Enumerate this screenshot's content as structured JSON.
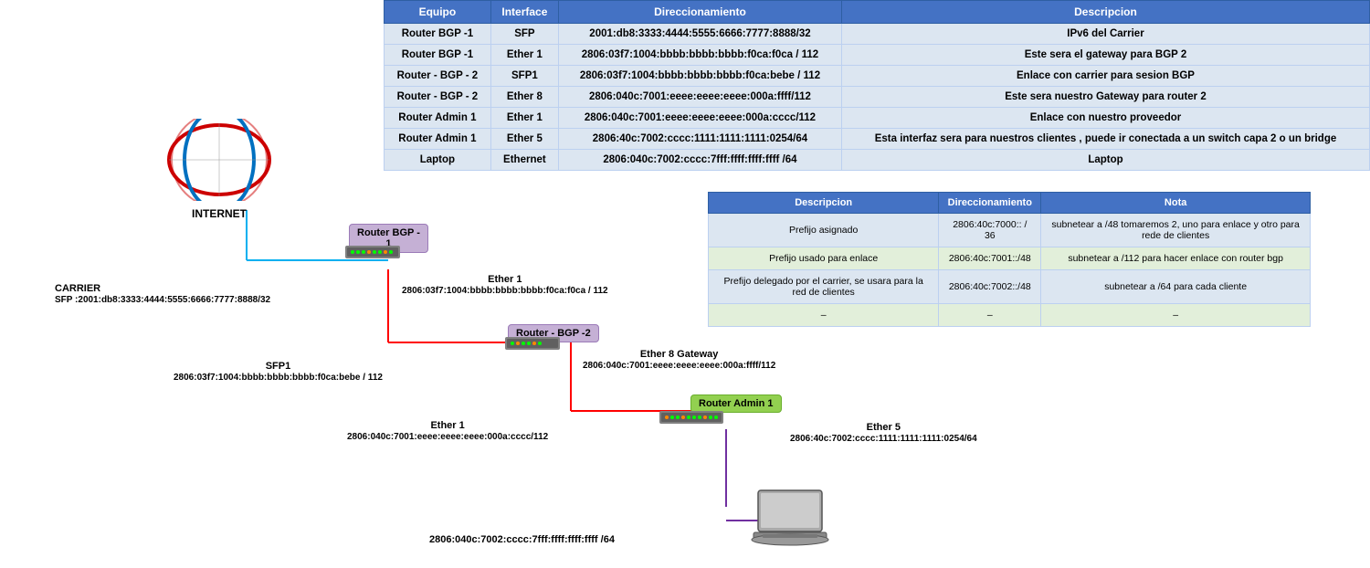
{
  "mainTable": {
    "headers": [
      "Equipo",
      "Interface",
      "Direccionamiento",
      "Descripcion"
    ],
    "rows": [
      [
        "Router BGP -1",
        "SFP",
        "2001:db8:3333:4444:5555:6666:7777:8888/32",
        "IPv6 del Carrier"
      ],
      [
        "Router BGP -1",
        "Ether 1",
        "2806:03f7:1004:bbbb:bbbb:bbbb:f0ca:f0ca / 112",
        "Este sera el gateway para BGP 2"
      ],
      [
        "Router - BGP - 2",
        "SFP1",
        "2806:03f7:1004:bbbb:bbbb:bbbb:f0ca:bebe / 112",
        "Enlace con carrier para sesion BGP"
      ],
      [
        "Router - BGP - 2",
        "Ether 8",
        "2806:040c:7001:eeee:eeee:eeee:000a:ffff/112",
        "Este sera nuestro Gateway para router 2"
      ],
      [
        "Router Admin 1",
        "Ether 1",
        "2806:040c:7001:eeee:eeee:eeee:000a:cccc/112",
        "Enlace con nuestro proveedor"
      ],
      [
        "Router Admin 1",
        "Ether 5",
        "2806:40c:7002:cccc:1111:1111:1111:0254/64",
        "Esta interfaz sera para nuestros clientes , puede ir conectada a un switch capa 2 o un bridge"
      ],
      [
        "Laptop",
        "Ethernet",
        "2806:040c:7002:cccc:7fff:ffff:ffff:ffff /64",
        "Laptop"
      ]
    ]
  },
  "secondTable": {
    "headers": [
      "Descripcion",
      "Direccionamiento",
      "Nota"
    ],
    "rows": [
      [
        "Prefijo asignado",
        "2806:40c:7000:: / 36",
        "subnetear a /48  tomaremos 2, uno para enlace y otro para rede de clientes"
      ],
      [
        "Prefijo usado para enlace",
        "2806:40c:7001::/48",
        "subnetear a /112 para hacer enlace con router bgp"
      ],
      [
        "Prefijo delegado por el carrier, se usara para la red de clientes",
        "2806:40c:7002::/48",
        "subnetear a /64 para cada cliente"
      ],
      [
        "–",
        "–",
        "–"
      ]
    ]
  },
  "diagram": {
    "internet": {
      "label": "INTERNET",
      "carrier": "CARRIER",
      "sfp": "SFP :2001:db8:3333:4444:5555:6666:7777:8888/32"
    },
    "routerBGP1": {
      "name": "Router BGP -\n1",
      "ether1_label": "Ether 1",
      "ether1_addr": "2806:03f7:1004:bbbb:bbbb:bbbb:f0ca:f0ca / 112"
    },
    "routerBGP2": {
      "name": "Router - BGP -2",
      "sfp1_label": "SFP1",
      "sfp1_addr": "2806:03f7:1004:bbbb:bbbb:bbbb:f0ca:bebe / 112",
      "ether1_label": "Ether 1",
      "ether1_addr": "2806:040c:7001:eeee:eeee:eeee:000a:cccc/112",
      "ether8_label": "Ether 8 Gateway",
      "ether8_addr": "2806:040c:7001:eeee:eeee:eeee:000a:ffff/112"
    },
    "routerAdmin1": {
      "name": "Router Admin 1",
      "ether5_label": "Ether 5",
      "ether5_addr": "2806:40c:7002:cccc:1111:1111:1111:0254/64"
    },
    "laptop": {
      "eth_addr": "2806:040c:7002:cccc:7fff:ffff:ffff:ffff /64"
    }
  }
}
